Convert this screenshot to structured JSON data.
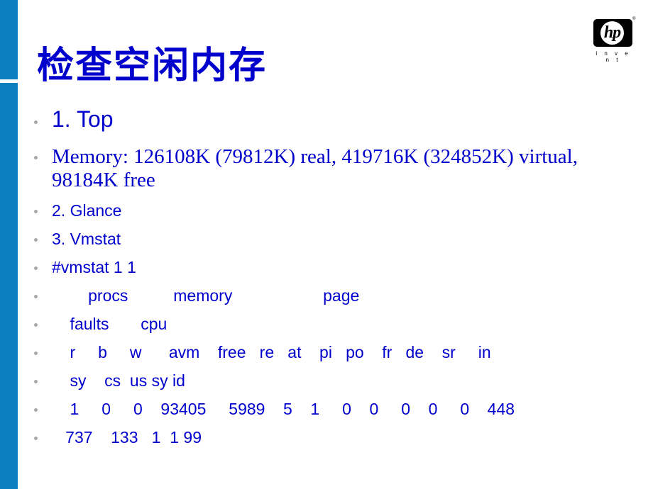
{
  "slide": {
    "title": "检查空闲内存",
    "logo": {
      "brand": "hp",
      "tagline": "i n v e n t",
      "registered": "®"
    },
    "bullets": [
      {
        "text": "1. Top"
      },
      {
        "text": "Memory: 126108K (79812K) real, 419716K (324852K) virtual,",
        "text2": "98184K free"
      },
      {
        "text": "2. Glance"
      },
      {
        "text": "3. Vmstat"
      },
      {
        "text": "#vmstat 1 1"
      },
      {
        "text": "        procs          memory                    page"
      },
      {
        "text": "    faults       cpu"
      },
      {
        "text": "    r     b     w      avm    free   re   at    pi   po    fr   de    sr     in"
      },
      {
        "text": "    sy    cs  us sy id"
      },
      {
        "text": "    1     0     0    93405     5989    5    1     0    0     0    0     0    448"
      },
      {
        "text": "   737    133   1  1 99"
      }
    ]
  },
  "colors": {
    "accent_bar": "#0a7fc0",
    "text": "#0000cc",
    "bullet_dot": "#a8a8a8"
  }
}
